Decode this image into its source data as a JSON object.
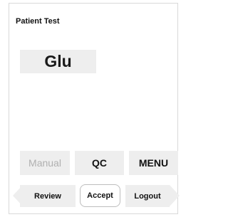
{
  "header": {
    "title": "Patient Test"
  },
  "test": {
    "name": "Glu"
  },
  "actions": {
    "manual_label": "Manual",
    "manual_enabled": false,
    "qc_label": "QC",
    "menu_label": "MENU"
  },
  "navigation": {
    "review_label": "Review",
    "accept_label": "Accept",
    "logout_label": "Logout"
  },
  "colors": {
    "button_bg": "#eeeeee",
    "disabled_text": "#b0b0b0",
    "text": "#111111",
    "border": "#d9d9d9"
  }
}
